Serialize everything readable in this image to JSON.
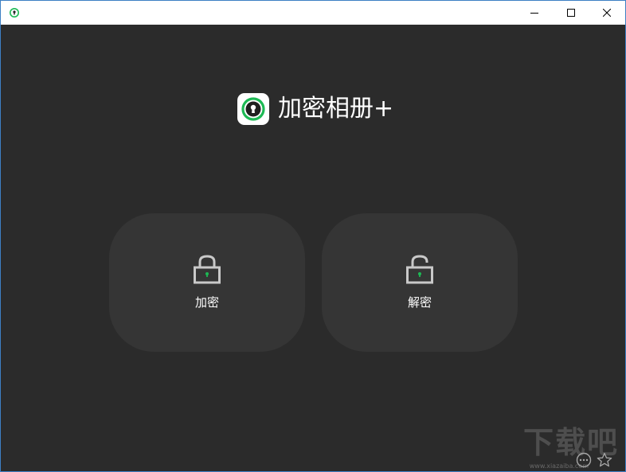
{
  "app": {
    "name": "加密相册+"
  },
  "actions": {
    "encrypt_label": "加密",
    "decrypt_label": "解密"
  },
  "watermark": {
    "text": "下载吧",
    "url": "www.xiazaiba.com"
  },
  "colors": {
    "background": "#2b2b2b",
    "card": "#353535",
    "accent_green": "#1db954",
    "titlebar": "#ffffff",
    "window_border": "#3d7fc4"
  },
  "icons": {
    "title": "keyhole-logo-icon",
    "minimize": "minimize-icon",
    "maximize": "maximize-icon",
    "close": "close-icon",
    "encrypt": "lock-closed-icon",
    "decrypt": "lock-open-icon"
  }
}
